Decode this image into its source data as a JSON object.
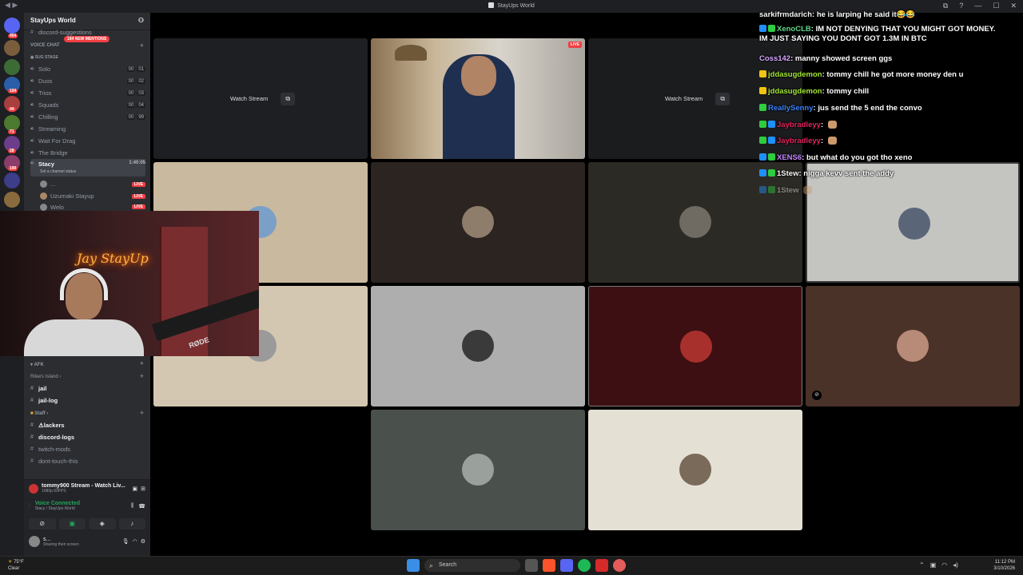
{
  "window": {
    "title": "StayUps World",
    "controls": [
      "—",
      "☐",
      "✕"
    ]
  },
  "rail": {
    "badges": [
      "404",
      "194",
      "44",
      "71",
      "28",
      "190"
    ]
  },
  "sidebar": {
    "server_name": "StayUps World",
    "top_channel": "discord-suggestions",
    "mentions_pill": "194 NEW MENTIONS",
    "voice_category": "VOICE CHAT",
    "stage_label": "SUG STAGE",
    "voice_channels": [
      {
        "name": "Solo",
        "a": "00",
        "b": "01"
      },
      {
        "name": "Duos",
        "a": "00",
        "b": "02"
      },
      {
        "name": "Trios",
        "a": "00",
        "b": "03"
      },
      {
        "name": "Squads",
        "a": "00",
        "b": "04"
      },
      {
        "name": "Chilling",
        "a": "00",
        "b": "99"
      },
      {
        "name": "Streaming"
      },
      {
        "name": "Wait For Drag"
      },
      {
        "name": "The Bridge"
      }
    ],
    "active_channel": {
      "name": "Stacy",
      "time": "1:40:05",
      "status": "Set a channel status"
    },
    "members": [
      {
        "name": "...",
        "live": "LIVE"
      },
      {
        "name": "Uzumaki Stayup",
        "live": "LIVE"
      },
      {
        "name": "Welo",
        "live": "LIVE"
      }
    ],
    "afk_category": "AFK",
    "rikers_category": "Rikers Island",
    "rikers_channels": [
      "jail",
      "jail-log"
    ],
    "staff_category": "Staff",
    "staff_channels": [
      "lackers",
      "discord-logs",
      "twitch-mods",
      "dont-touch-this"
    ]
  },
  "voice_panel": {
    "stream_title": "tommy900 Stream - Watch Liv...",
    "stream_quality": "1080p 60FPS",
    "voice_status": "Voice Connected",
    "voice_location": "Stacy / StayUps World",
    "user_name": "s...",
    "user_status": "Sharing their screen"
  },
  "webcam": {
    "neon_sign": "Jay StayUp",
    "mic_brand": "RØDE"
  },
  "stage": {
    "watch_stream_label": "Watch Stream",
    "live_label": "LIVE"
  },
  "chat": [
    {
      "user": "sarkifrmdarich",
      "color": "#f5f5f5",
      "text": "he is larping he said it😂😂"
    },
    {
      "user": "XenoCLB",
      "color": "#5ed88a",
      "text": "IM NOT DENYING THAT YOU MIGHT GOT MONEY. IM JUST SAYING YOU DONT GOT 1.3M IN BTC"
    },
    {
      "user": "Coss142",
      "color": "#d7a6ff",
      "text": "manny showed screen ggs"
    },
    {
      "user": "jddasugdemon",
      "color": "#a3e635",
      "text": "tommy chill he got more money den u"
    },
    {
      "user": "jddasugdemon",
      "color": "#a3e635",
      "text": "tommy chill"
    },
    {
      "user": "ReallySenny",
      "color": "#3b82f6",
      "text": "jus send the 5 end the convo"
    },
    {
      "user": "Jaybradleyy",
      "color": "#e0245e",
      "text": ""
    },
    {
      "user": "Jaybradleyy",
      "color": "#e0245e",
      "text": ""
    },
    {
      "user": "XENS6",
      "color": "#c084fc",
      "text": "but what do you got tho xeno"
    },
    {
      "user": "1Stew",
      "color": "#f5f5f5",
      "text": "nigga kevv sent the addy"
    },
    {
      "user": "1Stew",
      "color": "#f5f5f5",
      "text": ""
    }
  ],
  "taskbar": {
    "temp": "75°F",
    "weather": "Clear",
    "search_label": "Search",
    "time": "11:12 PM",
    "date": "3/10/2026"
  },
  "colors": {
    "accent_red": "#f23f43",
    "sidebar_bg": "#2b2d31",
    "rail_bg": "#1e1f22"
  }
}
